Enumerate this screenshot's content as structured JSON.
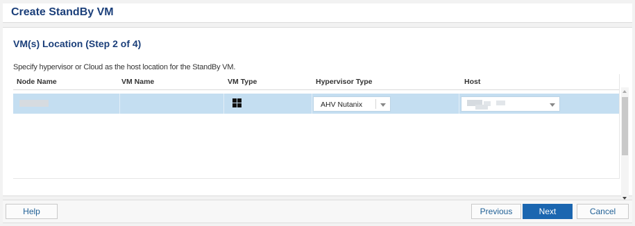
{
  "window": {
    "title": "Create StandBy VM"
  },
  "step": {
    "title": "VM(s) Location (Step 2 of 4)",
    "description": "Specify hypervisor or Cloud as the host location for the StandBy VM."
  },
  "table": {
    "columns": [
      "Node Name",
      "VM Name",
      "VM Type",
      "Hypervisor Type",
      "Host"
    ],
    "rows": [
      {
        "node_name": "",
        "vm_name": "",
        "vm_type_icon": "windows-icon",
        "hypervisor_type": "AHV Nutanix",
        "host": ""
      }
    ]
  },
  "footer": {
    "help": "Help",
    "previous": "Previous",
    "next": "Next",
    "cancel": "Cancel"
  },
  "colors": {
    "title": "#1b3f7a",
    "selected_row": "#c4def1",
    "primary_button": "#1b66b0",
    "button_text": "#1f5f95"
  }
}
